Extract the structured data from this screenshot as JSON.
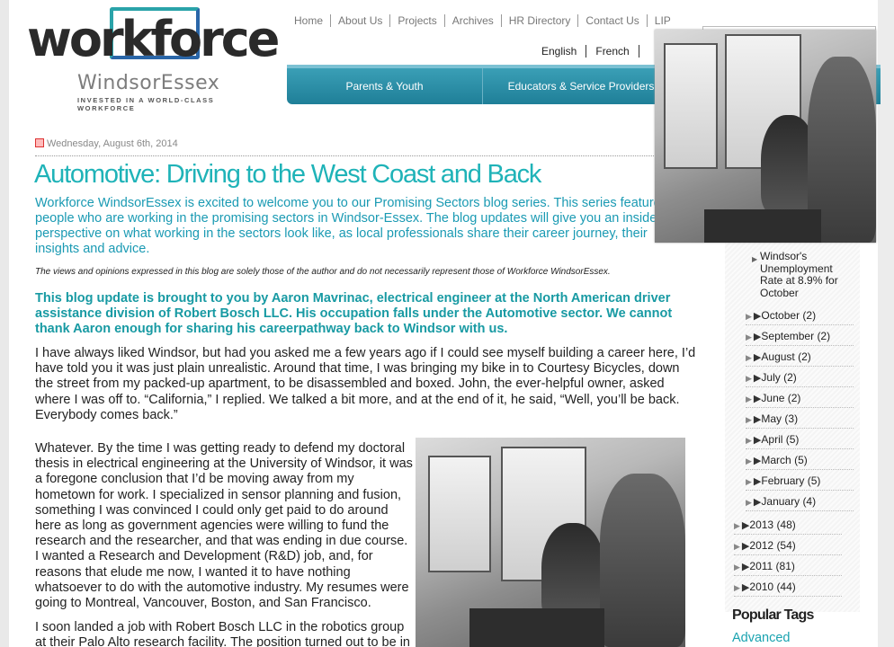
{
  "logo": {
    "word": "workforce",
    "sub": "WindsorEssex",
    "tagline": "INVESTED IN A WORLD-CLASS WORKFORCE"
  },
  "top_nav": [
    "Home",
    "About Us",
    "Projects",
    "Archives",
    "HR Directory",
    "Contact Us",
    "LIP"
  ],
  "lang_nav": [
    "English",
    "French"
  ],
  "main_menu": [
    "Parents & Youth",
    "Educators & Service Providers"
  ],
  "article": {
    "date": "Wednesday, August 6th, 2014",
    "title": "Automotive: Driving to the West Coast and Back",
    "intro": "Workforce WindsorEssex is excited to welcome you to our Promising Sectors blog series. This series features people who are working in the promising sectors in Windsor-Essex. The blog updates will give you an insider perspective on what working in the sectors look like, as local professionals share their career journey, their insights and advice.",
    "disclaimer": "The views and opinions expressed in this blog are solely those of the author and do not necessarily represent those of Workforce WindsorEssex.",
    "lead": "This blog update is brought to you by Aaron Mavrinac, electrical engineer at the North American driver assistance division of Robert Bosch LLC. His occupation falls under the Automotive sector. We cannot thank Aaron enough for sharing his careerpathway back to Windsor with us.",
    "p1": "I have always liked Windsor, but had you asked me a few years ago if I could see myself building a career here, I’d have told you it was just plain unrealistic. Around that time, I was bringing my bike in to Courtesy Bicycles, down the street from my packed-up apartment, to be disassembled and boxed. John, the ever-helpful owner, asked where I was off to. “California,” I replied. We talked a bit more, and at the end of it, he said, “Well, you’ll be back. Everybody comes back.”",
    "p2": "Whatever. By the time I was getting ready to defend my doctoral thesis in electrical engineering at the University of Windsor, it was a foregone conclusion that I’d be moving away from my hometown for work. I specialized in sensor planning and fusion, something I was convinced I could only get paid to do around here as long as government agencies were willing to fund the research and the researcher, and that was ending in due course. I wanted a Research and Development (R&D) job, and, for reasons that elude me now, I wanted it to have nothing whatsoever to do with the automotive industry. My resumes were going to Montreal, Vancouver, Boston, and San Francisco.",
    "p3": "I soon landed a job with Robert Bosch LLC in the robotics group at their Palo Alto research facility. The position turned out to be in"
  },
  "sidebar": {
    "news_item": "Windsor's Unemployment Rate at 8.9% for October",
    "months": [
      {
        "label": "October",
        "count": "(2)"
      },
      {
        "label": "September",
        "count": "(2)"
      },
      {
        "label": "August",
        "count": "(2)"
      },
      {
        "label": "July",
        "count": "(2)"
      },
      {
        "label": "June",
        "count": "(2)"
      },
      {
        "label": "May",
        "count": "(3)"
      },
      {
        "label": "April",
        "count": "(5)"
      },
      {
        "label": "March",
        "count": "(5)"
      },
      {
        "label": "February",
        "count": "(5)"
      },
      {
        "label": "January",
        "count": "(4)"
      }
    ],
    "years": [
      {
        "label": "2013",
        "count": "(48)"
      },
      {
        "label": "2012",
        "count": "(54)"
      },
      {
        "label": "2011",
        "count": "(81)"
      },
      {
        "label": "2010",
        "count": "(44)"
      }
    ],
    "popular_tags_heading": "Popular Tags",
    "first_tag": "Advanced"
  }
}
